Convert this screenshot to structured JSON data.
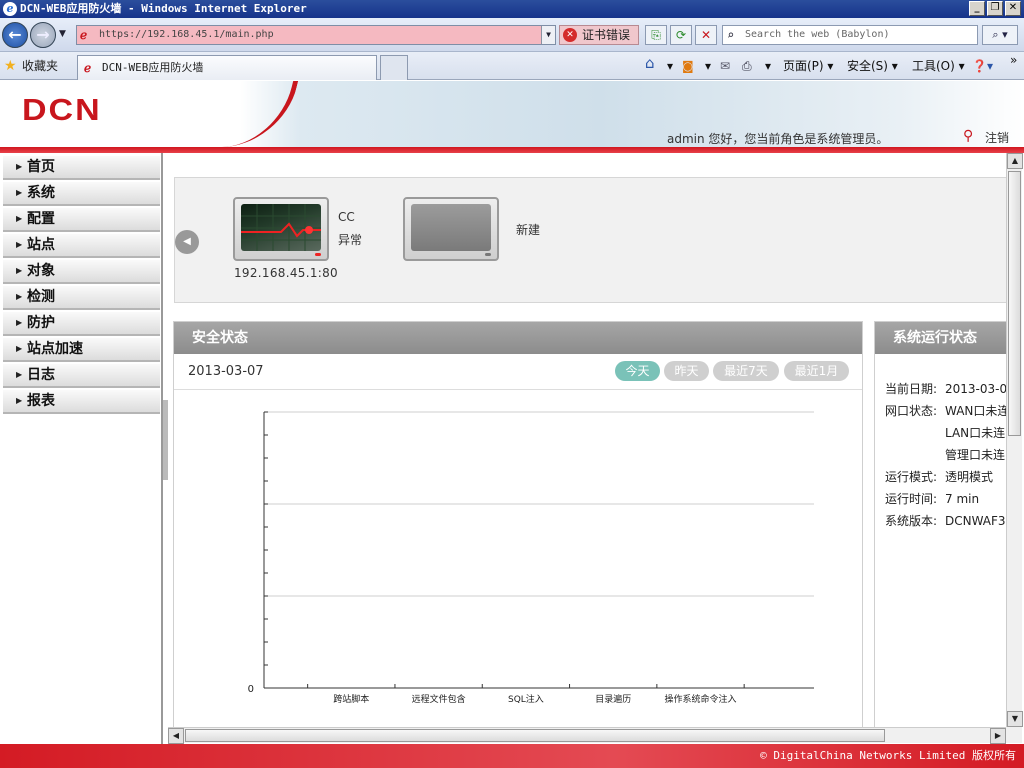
{
  "browser": {
    "window_title": "DCN-WEB应用防火墙 - Windows Internet Explorer",
    "url": "https://192.168.45.1/main.php",
    "cert_error": "证书错误",
    "search_placeholder": "Search the web (Babylon)",
    "favorites_label": "收藏夹",
    "tab_title": "DCN-WEB应用防火墙",
    "cmd_page": "页面(P)",
    "cmd_safety": "安全(S)",
    "cmd_tools": "工具(O)"
  },
  "header": {
    "logo_text": "DCN",
    "welcome": "admin 您好，您当前角色是系统管理员。",
    "logout": "注销"
  },
  "sidebar": {
    "items": [
      {
        "label": "首页"
      },
      {
        "label": "系统"
      },
      {
        "label": "配置"
      },
      {
        "label": "站点"
      },
      {
        "label": "对象"
      },
      {
        "label": "检测"
      },
      {
        "label": "防护"
      },
      {
        "label": "站点加速"
      },
      {
        "label": "日志"
      },
      {
        "label": "报表"
      }
    ]
  },
  "sites": [
    {
      "name": "CC",
      "status": "异常",
      "ip": "192.168.45.1:80"
    },
    {
      "name": "新建",
      "status": "",
      "ip": ""
    }
  ],
  "security": {
    "title": "安全状态",
    "date": "2013-03-07",
    "filters": [
      {
        "label": "今天",
        "active": true
      },
      {
        "label": "昨天",
        "active": false
      },
      {
        "label": "最近7天",
        "active": false
      },
      {
        "label": "最近1月",
        "active": false
      }
    ]
  },
  "chart_data": {
    "type": "bar",
    "categories": [
      "跨站脚本",
      "远程文件包含",
      "SQL注入",
      "目录遍历",
      "操作系统命令注入"
    ],
    "values": [
      0,
      0,
      0,
      0,
      0
    ],
    "ytick_labels": [
      "0"
    ],
    "grid": true
  },
  "system": {
    "title": "系统运行状态",
    "rows": [
      {
        "key": "当前日期:",
        "value": "2013-03-0"
      },
      {
        "key": "网口状态:",
        "value": "WAN口未连"
      },
      {
        "key": "",
        "value": "LAN口未连"
      },
      {
        "key": "",
        "value": "管理口未连"
      },
      {
        "key": "运行模式:",
        "value": "透明模式"
      },
      {
        "key": "运行时间:",
        "value": "7 min"
      },
      {
        "key": "系统版本:",
        "value": "DCNWAF3"
      }
    ]
  },
  "footer": {
    "copyright": "© DigitalChina Networks Limited 版权所有"
  },
  "colors": {
    "brand_red": "#c8161d",
    "active_pill": "#7ac2b8",
    "panel_header": "#999999"
  }
}
